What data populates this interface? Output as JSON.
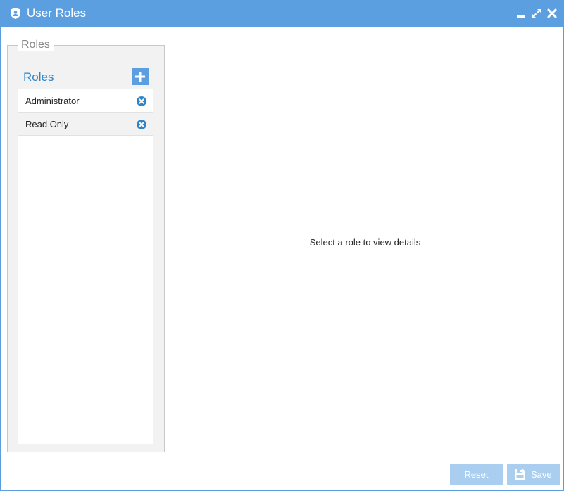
{
  "window": {
    "title": "User Roles",
    "title_icon": "shield-user-icon",
    "controls": [
      "minimize-icon",
      "maximize-icon",
      "close-icon"
    ]
  },
  "roles_group": {
    "legend": "Roles"
  },
  "roles_panel": {
    "title": "Roles",
    "add_icon": "plus-icon",
    "items": [
      {
        "label": "Administrator",
        "remove_icon": "remove-circle-icon"
      },
      {
        "label": "Read Only",
        "remove_icon": "remove-circle-icon"
      }
    ]
  },
  "details": {
    "empty_message": "Select a role to view details"
  },
  "footer": {
    "reset_label": "Reset",
    "save_label": "Save",
    "save_icon": "floppy-disk-icon"
  },
  "colors": {
    "titlebar": "#5b9fe0",
    "accent_text": "#2f85c8",
    "remove_icon": "#2f85c8",
    "disabled_button": "#a9cef0"
  }
}
